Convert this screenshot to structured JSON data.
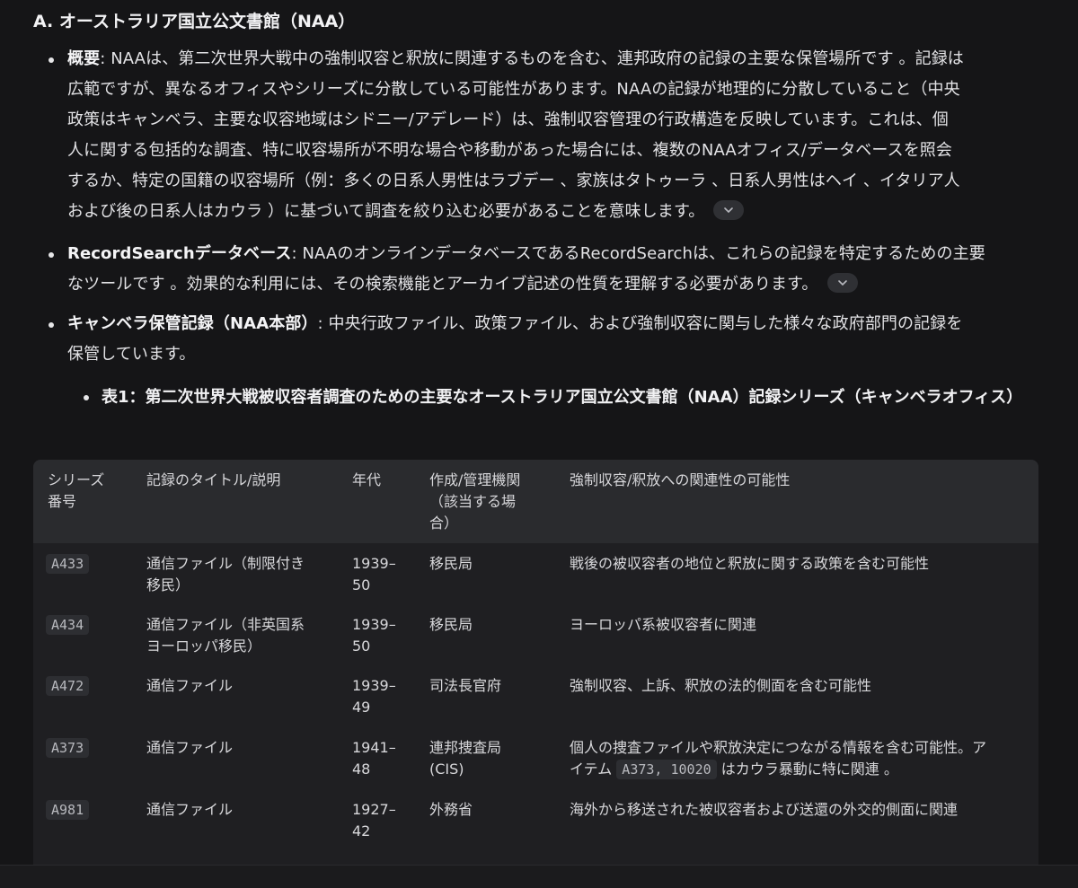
{
  "heading": "A. オーストラリア国立公文書館（NAA）",
  "bullets": [
    {
      "label": "概要",
      "sep": ": ",
      "lines": [
        "NAAは、第二次世界大戦中の強制収容と釈放に関連するものを含む、連邦政府の記録の主要な保管場所です 。記録は",
        "広範ですが、異なるオフィスやシリーズに分散している可能性があります。NAAの記録が地理的に分散していること（中央",
        "政策はキャンベラ、主要な収容地域はシドニー/アデレード）は、強制収容管理の行政構造を反映しています。これは、個",
        "人に関する包括的な調査、特に収容場所が不明な場合や移動があった場合には、複数のNAAオフィス/データベースを照会",
        "するか、特定の国籍の収容場所（例：多くの日系人男性はラブデー 、家族はタトゥーラ 、日系人男性はヘイ 、イタリア人",
        "および後の日系人はカウラ ）に基づいて調査を絞り込む必要があることを意味します。"
      ],
      "has_expand": true
    },
    {
      "label": "RecordSearchデータベース",
      "sep": ": ",
      "lines": [
        "NAAのオンラインデータベースであるRecordSearchは、これらの記録を特定するための主要",
        "なツールです 。効果的な利用には、その検索機能とアーカイブ記述の性質を理解する必要があります。"
      ],
      "has_expand": true
    },
    {
      "label": "キャンベラ保管記録（NAA本部）",
      "sep": ": ",
      "lines": [
        "中央行政ファイル、政策ファイル、および強制収容に関与した様々な政府部門の記録を",
        "保管しています。"
      ],
      "has_expand": false
    }
  ],
  "table_title": "表1：第二次世界大戦被収容者調査のための主要なオーストラリア国立公文書館（NAA）記録シリーズ（キャンベラオフィス）",
  "table": {
    "headers": [
      [
        "シリーズ",
        "番号"
      ],
      [
        "記録のタイトル/説明"
      ],
      [
        "年代"
      ],
      [
        "作成/管理機関",
        "（該当する場",
        "合）"
      ],
      [
        "強制収容/釈放への関連性の可能性"
      ]
    ],
    "rows": [
      {
        "series": "A433",
        "title": [
          "通信ファイル（制限付き",
          "移民）"
        ],
        "years": [
          "1939–",
          "50"
        ],
        "agency": [
          "移民局"
        ],
        "relevance": [
          "戦後の被収容者の地位と釈放に関する政策を含む可能性"
        ]
      },
      {
        "series": "A434",
        "title": [
          "通信ファイル（非英国系",
          "ヨーロッパ移民）"
        ],
        "years": [
          "1939–",
          "50"
        ],
        "agency": [
          "移民局"
        ],
        "relevance": [
          "ヨーロッパ系被収容者に関連"
        ]
      },
      {
        "series": "A472",
        "title": [
          "通信ファイル"
        ],
        "years": [
          "1939–",
          "49"
        ],
        "agency": [
          "司法長官府"
        ],
        "relevance": [
          "強制収容、上訴、釈放の法的側面を含む可能性"
        ]
      },
      {
        "series": "A373",
        "title": [
          "通信ファイル"
        ],
        "years": [
          "1941–",
          "48"
        ],
        "agency": [
          "連邦捜査局",
          "(CIS)"
        ],
        "relevance": [
          "個人の捜査ファイルや釈放決定につながる情報を含む可能性。ア"
        ],
        "relevance_line2_pre": "イテム",
        "relevance_code": "A373, 10020",
        "relevance_line2_post": "はカウラ暴動に特に関連 。"
      },
      {
        "series": "A981",
        "title": [
          "通信ファイル"
        ],
        "years": [
          "1927–",
          "42"
        ],
        "agency": [
          "外務省"
        ],
        "relevance": [
          "海外から移送された被収容者および送還の外交的側面に関連"
        ]
      }
    ]
  }
}
